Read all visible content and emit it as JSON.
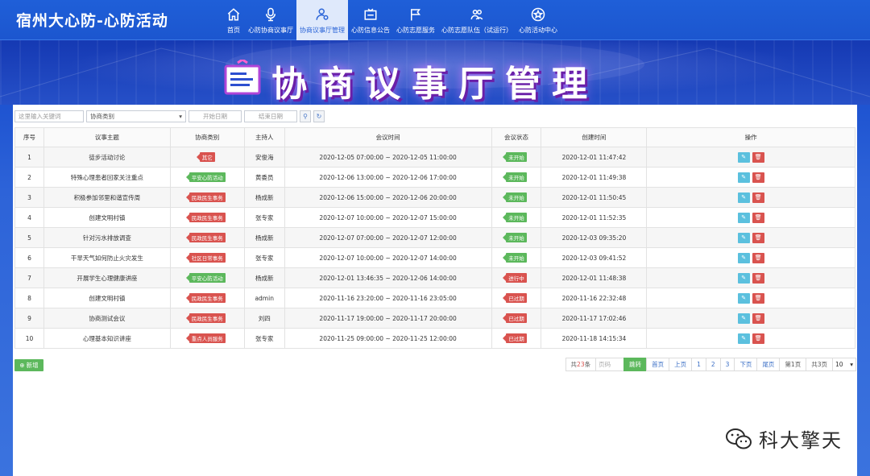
{
  "app": {
    "title": "宿州大心防-心防活动"
  },
  "nav": [
    {
      "label": "首页",
      "icon": "home-icon",
      "active": false
    },
    {
      "label": "心防协商议事厅",
      "icon": "microphone-icon",
      "active": false
    },
    {
      "label": "协商议事厅管理",
      "icon": "user-settings-icon",
      "active": true
    },
    {
      "label": "心防信息公告",
      "icon": "notice-board-icon",
      "active": false
    },
    {
      "label": "心防志愿服务",
      "icon": "flag-icon",
      "active": false
    },
    {
      "label": "心防志愿队伍（试运行）",
      "icon": "team-icon",
      "active": false
    },
    {
      "label": "心防活动中心",
      "icon": "star-icon",
      "active": false
    }
  ],
  "banner": {
    "title": "协商议事厅管理"
  },
  "toolbar": {
    "search_placeholder": "这里输入关键词",
    "category_select": "协商类别",
    "start_date": "开始日期",
    "end_date": "结束日期"
  },
  "table": {
    "headers": [
      "序号",
      "议事主题",
      "协商类别",
      "主持人",
      "会议时间",
      "会议状态",
      "创建时间",
      "操作"
    ],
    "rows": [
      {
        "no": "1",
        "topic": "徒步活动讨论",
        "category": "其它",
        "category_color": "red",
        "host": "安俊海",
        "time": "2020-12-05 07:00:00 ~ 2020-12-05 11:00:00",
        "status": "未开始",
        "status_color": "green",
        "created": "2020-12-01 11:47:42"
      },
      {
        "no": "2",
        "topic": "特殊心理患者回家关注重点",
        "category": "平安心防活动",
        "category_color": "green",
        "host": "黄委员",
        "time": "2020-12-06 13:00:00 ~ 2020-12-06 17:00:00",
        "status": "未开始",
        "status_color": "green",
        "created": "2020-12-01 11:49:38"
      },
      {
        "no": "3",
        "topic": "积极参加邻里和谐宣传周",
        "category": "民政民生事务",
        "category_color": "red",
        "host": "杨成新",
        "time": "2020-12-06 15:00:00 ~ 2020-12-06 20:00:00",
        "status": "未开始",
        "status_color": "green",
        "created": "2020-12-01 11:50:45"
      },
      {
        "no": "4",
        "topic": "创建文明村镇",
        "category": "民政民生事务",
        "category_color": "red",
        "host": "张专家",
        "time": "2020-12-07 10:00:00 ~ 2020-12-07 15:00:00",
        "status": "未开始",
        "status_color": "green",
        "created": "2020-12-01 11:52:35"
      },
      {
        "no": "5",
        "topic": "针对污水排放调查",
        "category": "民政民生事务",
        "category_color": "red",
        "host": "杨成新",
        "time": "2020-12-07 07:00:00 ~ 2020-12-07 12:00:00",
        "status": "未开始",
        "status_color": "green",
        "created": "2020-12-03 09:35:20"
      },
      {
        "no": "6",
        "topic": "干旱天气如何防止火灾发生",
        "category": "社区日常事务",
        "category_color": "red",
        "host": "张专家",
        "time": "2020-12-07 10:00:00 ~ 2020-12-07 14:00:00",
        "status": "未开始",
        "status_color": "green",
        "created": "2020-12-03 09:41:52"
      },
      {
        "no": "7",
        "topic": "开展学生心理健康讲座",
        "category": "平安心防活动",
        "category_color": "green",
        "host": "杨成新",
        "time": "2020-12-01 13:46:35 ~ 2020-12-06 14:00:00",
        "status": "进行中",
        "status_color": "red",
        "created": "2020-12-01 11:48:38"
      },
      {
        "no": "8",
        "topic": "创建文明村镇",
        "category": "民政民生事务",
        "category_color": "red",
        "host": "admin",
        "time": "2020-11-16 23:20:00 ~ 2020-11-16 23:05:00",
        "status": "已过期",
        "status_color": "red",
        "created": "2020-11-16 22:32:48"
      },
      {
        "no": "9",
        "topic": "协商测试会议",
        "category": "民政民生事务",
        "category_color": "red",
        "host": "刘四",
        "time": "2020-11-17 19:00:00 ~ 2020-11-17 20:00:00",
        "status": "已过期",
        "status_color": "red",
        "created": "2020-11-17 17:02:46"
      },
      {
        "no": "10",
        "topic": "心理基本知识讲座",
        "category": "重点人员服务",
        "category_color": "red",
        "host": "张专家",
        "time": "2020-11-25 09:00:00 ~ 2020-11-25 12:00:00",
        "status": "已过期",
        "status_color": "red",
        "created": "2020-11-18 14:15:34"
      }
    ]
  },
  "add_button": "新增",
  "pager": {
    "total_prefix": "共",
    "total": "23",
    "total_suffix": "条",
    "page_input_placeholder": "页码",
    "go": "跳转",
    "first": "首页",
    "prev": "上页",
    "pages": [
      "1",
      "2",
      "3"
    ],
    "next": "下页",
    "last": "尾页",
    "current": "第1页",
    "total_pages": "共3页",
    "page_size": "10"
  },
  "watermark": {
    "text": "科大擎天"
  },
  "colors": {
    "primary": "#1f5fd8",
    "green": "#5cb85c",
    "red": "#d9534f",
    "info": "#5bc0de"
  }
}
